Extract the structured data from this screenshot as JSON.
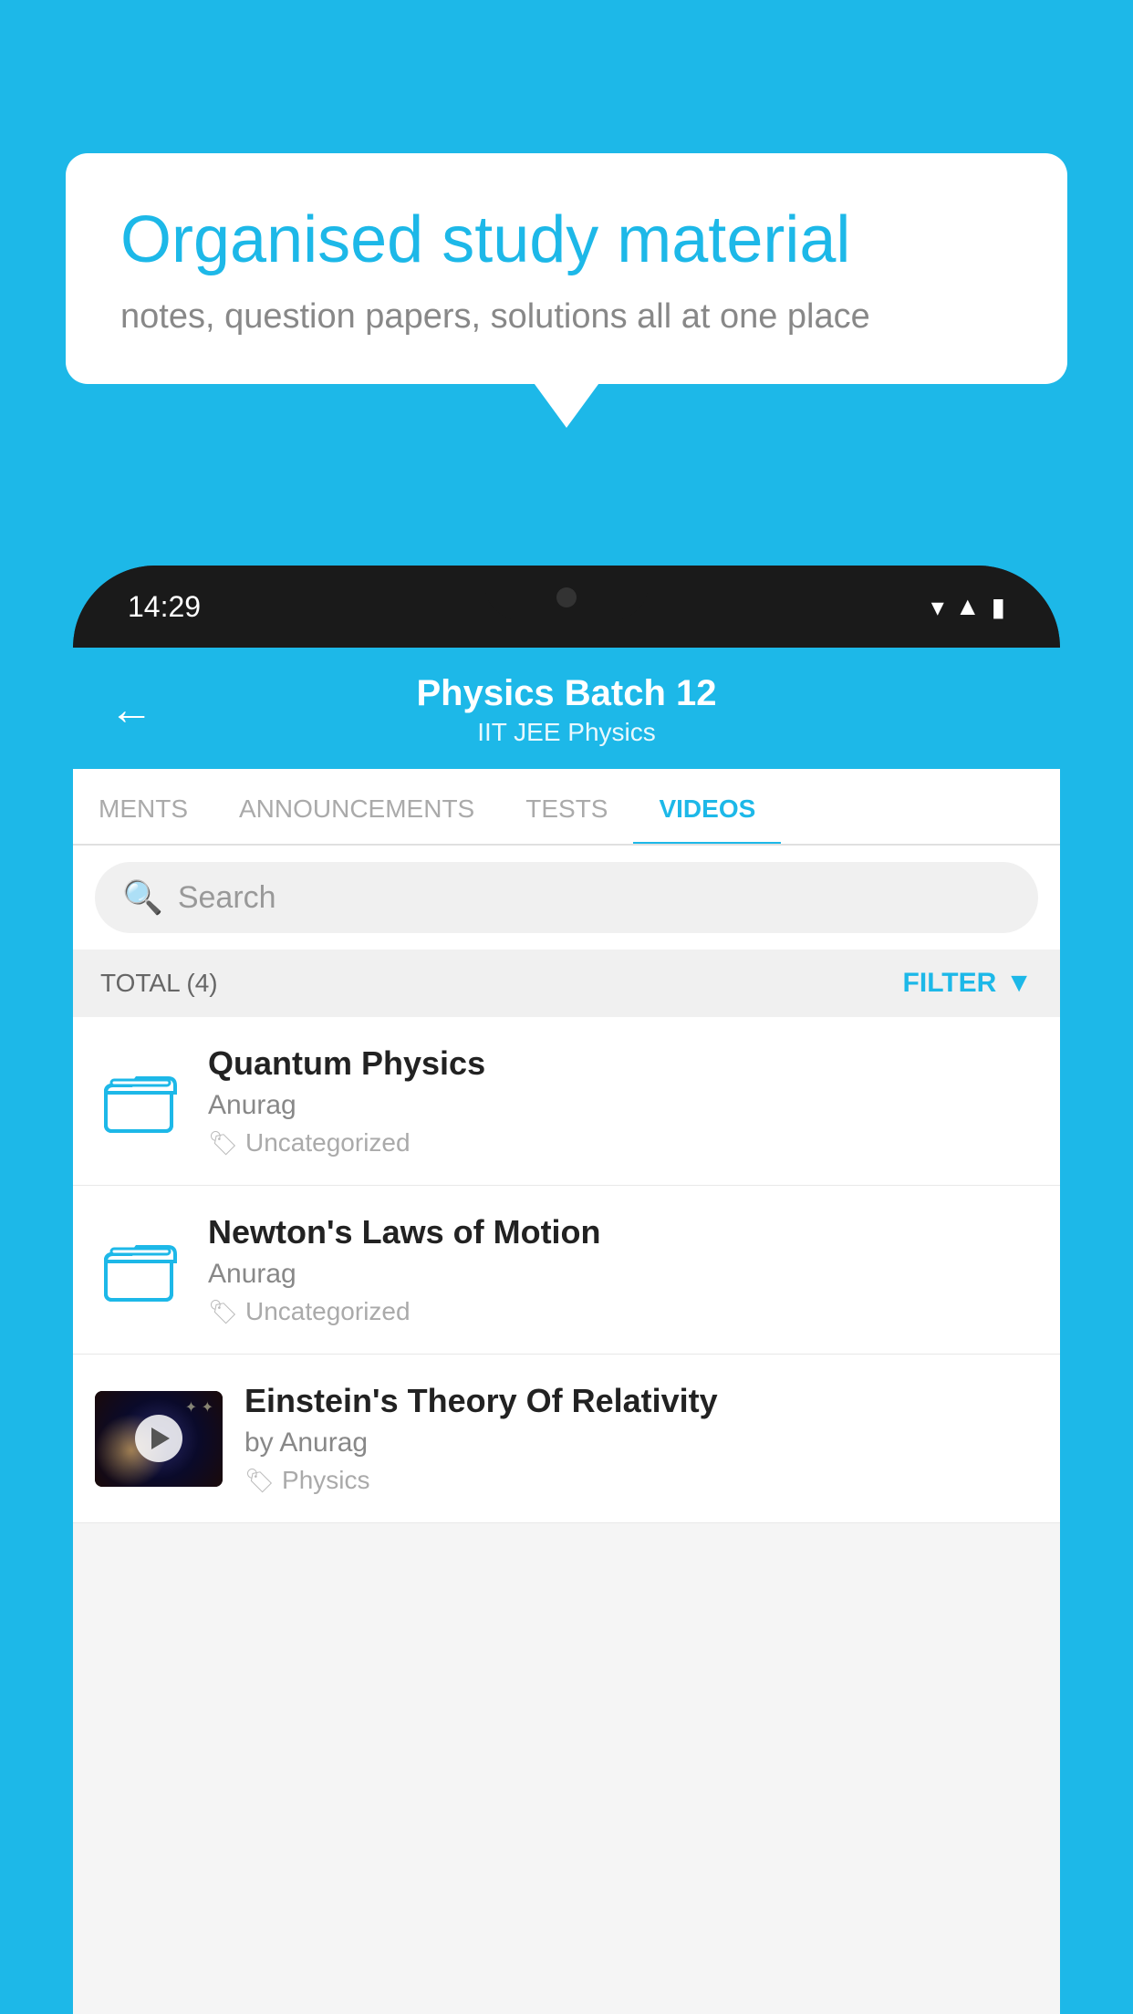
{
  "background_color": "#1db8e8",
  "speech_bubble": {
    "title": "Organised study material",
    "subtitle": "notes, question papers, solutions all at one place"
  },
  "phone": {
    "time": "14:29",
    "header": {
      "back_label": "←",
      "title": "Physics Batch 12",
      "subtitle": "IIT JEE   Physics"
    },
    "tabs": [
      {
        "label": "MENTS",
        "active": false
      },
      {
        "label": "ANNOUNCEMENTS",
        "active": false
      },
      {
        "label": "TESTS",
        "active": false
      },
      {
        "label": "VIDEOS",
        "active": true
      }
    ],
    "search": {
      "placeholder": "Search"
    },
    "filter": {
      "total_label": "TOTAL (4)",
      "filter_label": "FILTER"
    },
    "videos": [
      {
        "id": 1,
        "title": "Quantum Physics",
        "author": "Anurag",
        "tag": "Uncategorized",
        "has_thumbnail": false
      },
      {
        "id": 2,
        "title": "Newton's Laws of Motion",
        "author": "Anurag",
        "tag": "Uncategorized",
        "has_thumbnail": false
      },
      {
        "id": 3,
        "title": "Einstein's Theory Of Relativity",
        "author": "by Anurag",
        "tag": "Physics",
        "has_thumbnail": true
      }
    ]
  }
}
